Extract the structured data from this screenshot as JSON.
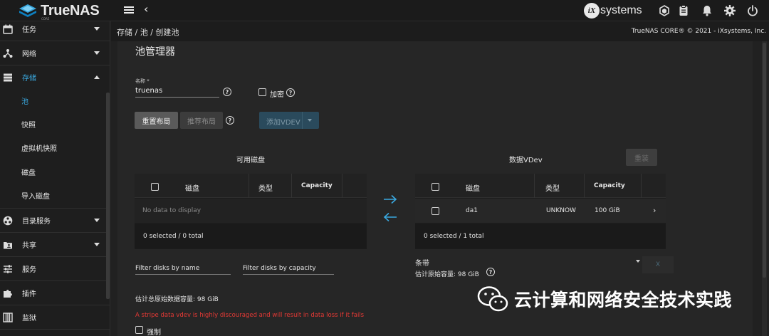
{
  "app": {
    "logo_text": "TrueNAS",
    "logo_sub": "CORE",
    "vendor_logo": "systems",
    "vendor_mark": "iX"
  },
  "topbar": {
    "icons": [
      "truecommand-icon",
      "clipboard-icon",
      "bell-icon",
      "gear-icon",
      "power-icon"
    ]
  },
  "sidebar": {
    "items": [
      {
        "label": "任务",
        "icon": "calendar-icon"
      },
      {
        "label": "网络",
        "icon": "network-icon"
      },
      {
        "label": "存储",
        "icon": "storage-icon",
        "expanded": true
      },
      {
        "label": "目录服务",
        "icon": "directory-icon"
      },
      {
        "label": "共享",
        "icon": "share-icon"
      },
      {
        "label": "服务",
        "icon": "services-icon"
      },
      {
        "label": "插件",
        "icon": "puzzle-icon"
      },
      {
        "label": "监狱",
        "icon": "jail-icon"
      }
    ],
    "storage_subitems": [
      {
        "label": "池",
        "active": true
      },
      {
        "label": "快照"
      },
      {
        "label": "虚拟机快照"
      },
      {
        "label": "磁盘"
      },
      {
        "label": "导入磁盘"
      }
    ]
  },
  "breadcrumb": {
    "text": "存储 / 池 / 创建池"
  },
  "copyright": "TrueNAS CORE® © 2021 - iXsystems, Inc.",
  "pool_manager": {
    "title": "池管理器",
    "name_label": "名称 *",
    "name_value": "truenas",
    "encrypt_label": "加密",
    "reset_layout": "重置布局",
    "suggest_layout": "推荐布局",
    "add_vdev": "添加VDEV",
    "reset_vdev": "重装"
  },
  "available_disks": {
    "title": "可用磁盘",
    "columns": [
      "磁盘",
      "类型",
      "Capacity"
    ],
    "empty_text": "No data to display",
    "footer": "0 selected / 0 total",
    "filter_name": "Filter disks by name",
    "filter_capacity": "Filter disks by capacity"
  },
  "data_vdev": {
    "title": "数据VDev",
    "columns": [
      "磁盘",
      "类型",
      "Capacity"
    ],
    "rows": [
      {
        "disk": "da1",
        "type": "UNKNOW",
        "capacity": "100 GiB"
      }
    ],
    "footer": "0 selected / 1 total",
    "layout": "条带",
    "est_capacity": "估计原始容量:  98 GiB",
    "x_label": "X"
  },
  "summary": {
    "est_total": "估计总原始数据容量: 98 GiB",
    "warning": "A stripe data vdev is highly discouraged and will result in data loss if it fails",
    "force_label": "强制"
  },
  "watermark": "云计算和网络安全技术实践",
  "colors": {
    "accent": "#3aa9e0",
    "warning": "#e53935",
    "background": "#212121"
  }
}
